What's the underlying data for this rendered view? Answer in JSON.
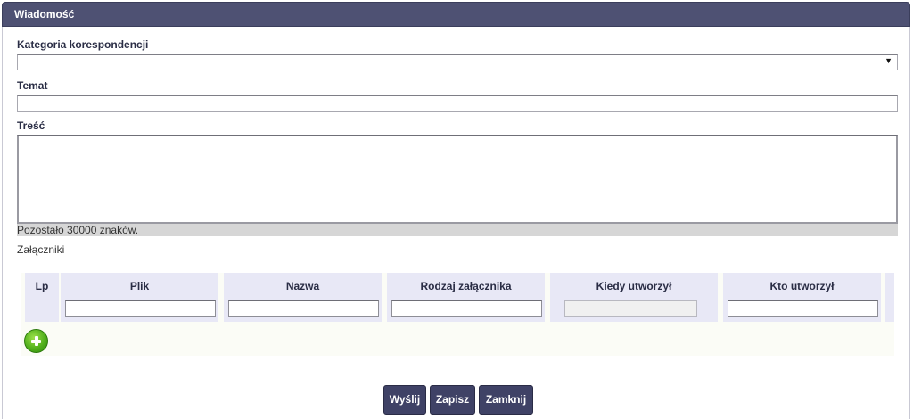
{
  "header": {
    "title": "Wiadomość"
  },
  "form": {
    "category_label": "Kategoria korespondencji",
    "category_value": "",
    "topic_label": "Temat",
    "topic_value": "",
    "body_label": "Treść",
    "body_value": "",
    "remaining_chars": "Pozostało 30000 znaków."
  },
  "attachments": {
    "label": "Załączniki",
    "columns": [
      "Lp",
      "Plik",
      "Nazwa",
      "Rodzaj załącznika",
      "Kiedy utworzył",
      "Kto utworzył"
    ],
    "add_icon": "plus-circle-icon"
  },
  "buttons": {
    "send": "Wyślij",
    "save": "Zapisz",
    "close": "Zamknij"
  },
  "colors": {
    "header_bg": "#4e5173",
    "button_bg": "#3f4266",
    "column_header_bg": "#e8e8f6",
    "add_green": "#52b01c"
  }
}
